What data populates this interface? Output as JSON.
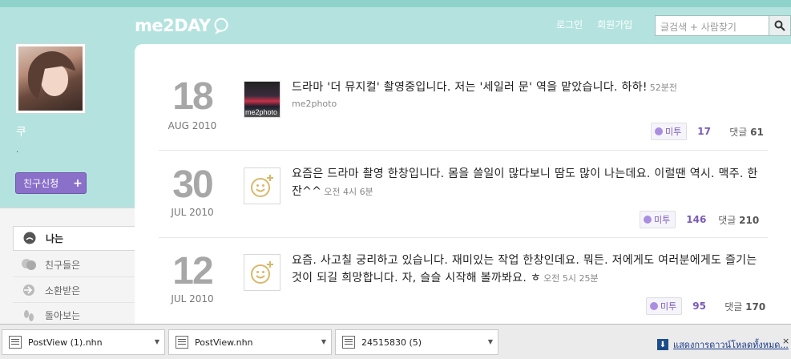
{
  "header": {
    "logo": "me2DAY",
    "nav": {
      "login": "로그인",
      "signup": "회원가입"
    },
    "search": {
      "placeholder": "글검색 + 사람찾기"
    }
  },
  "profile": {
    "name": "쿠",
    "subtitle": ".",
    "friend_button": "친구신청",
    "friend_button_plus": "+"
  },
  "sidebar": {
    "items": [
      {
        "label": "나는",
        "icon": "me-icon",
        "active": true
      },
      {
        "label": "친구들은",
        "icon": "friends-icon"
      },
      {
        "label": "소환받은",
        "icon": "summoned-icon"
      },
      {
        "label": "돌아보는",
        "icon": "footprints-icon"
      }
    ]
  },
  "posts": [
    {
      "day": "18",
      "month": "AUG 2010",
      "thumb": "photo",
      "thumb_label": "me2photo",
      "text": "드라마 '더 뮤지컬' 촬영중입니다. 저는 '세일러 문' 역을 맡았습니다. 하하!",
      "time": "52분전",
      "source": "me2photo",
      "me2_label": "미투",
      "me2_count": "17",
      "comment_label": "댓글",
      "comment_count": "61"
    },
    {
      "day": "30",
      "month": "JUL 2010",
      "thumb": "smile",
      "text": "요즘은 드라마 촬영 한창입니다. 몸을 쓸일이 많다보니 땀도 많이 나는데요. 이럴땐 역시. 맥주. 한잔^^",
      "time": "오전 4시 6분",
      "me2_label": "미투",
      "me2_count": "146",
      "comment_label": "댓글",
      "comment_count": "210"
    },
    {
      "day": "12",
      "month": "JUL 2010",
      "thumb": "smile",
      "text": "요즘. 사고칠 궁리하고 있습니다. 재미있는 작업 한창인데요. 뭐든. 저에게도 여러분에게도 즐기는 것이 되길 희망합니다. 자, 슬슬 시작해 볼까봐요. ㅎ",
      "time": "오전 5시 25분",
      "me2_label": "미투",
      "me2_count": "95",
      "comment_label": "댓글",
      "comment_count": "170"
    }
  ],
  "downloads": {
    "items": [
      {
        "name": "PostView (1).nhn"
      },
      {
        "name": "PostView.nhn"
      },
      {
        "name": "24515830 (5)"
      }
    ],
    "show_all": "แสดงการดาวน์โหลดทั้งหมด...",
    "close": "×"
  },
  "colors": {
    "teal": "#b4e3df",
    "purple": "#8a70c9",
    "date_gray": "#a7a7a7"
  }
}
